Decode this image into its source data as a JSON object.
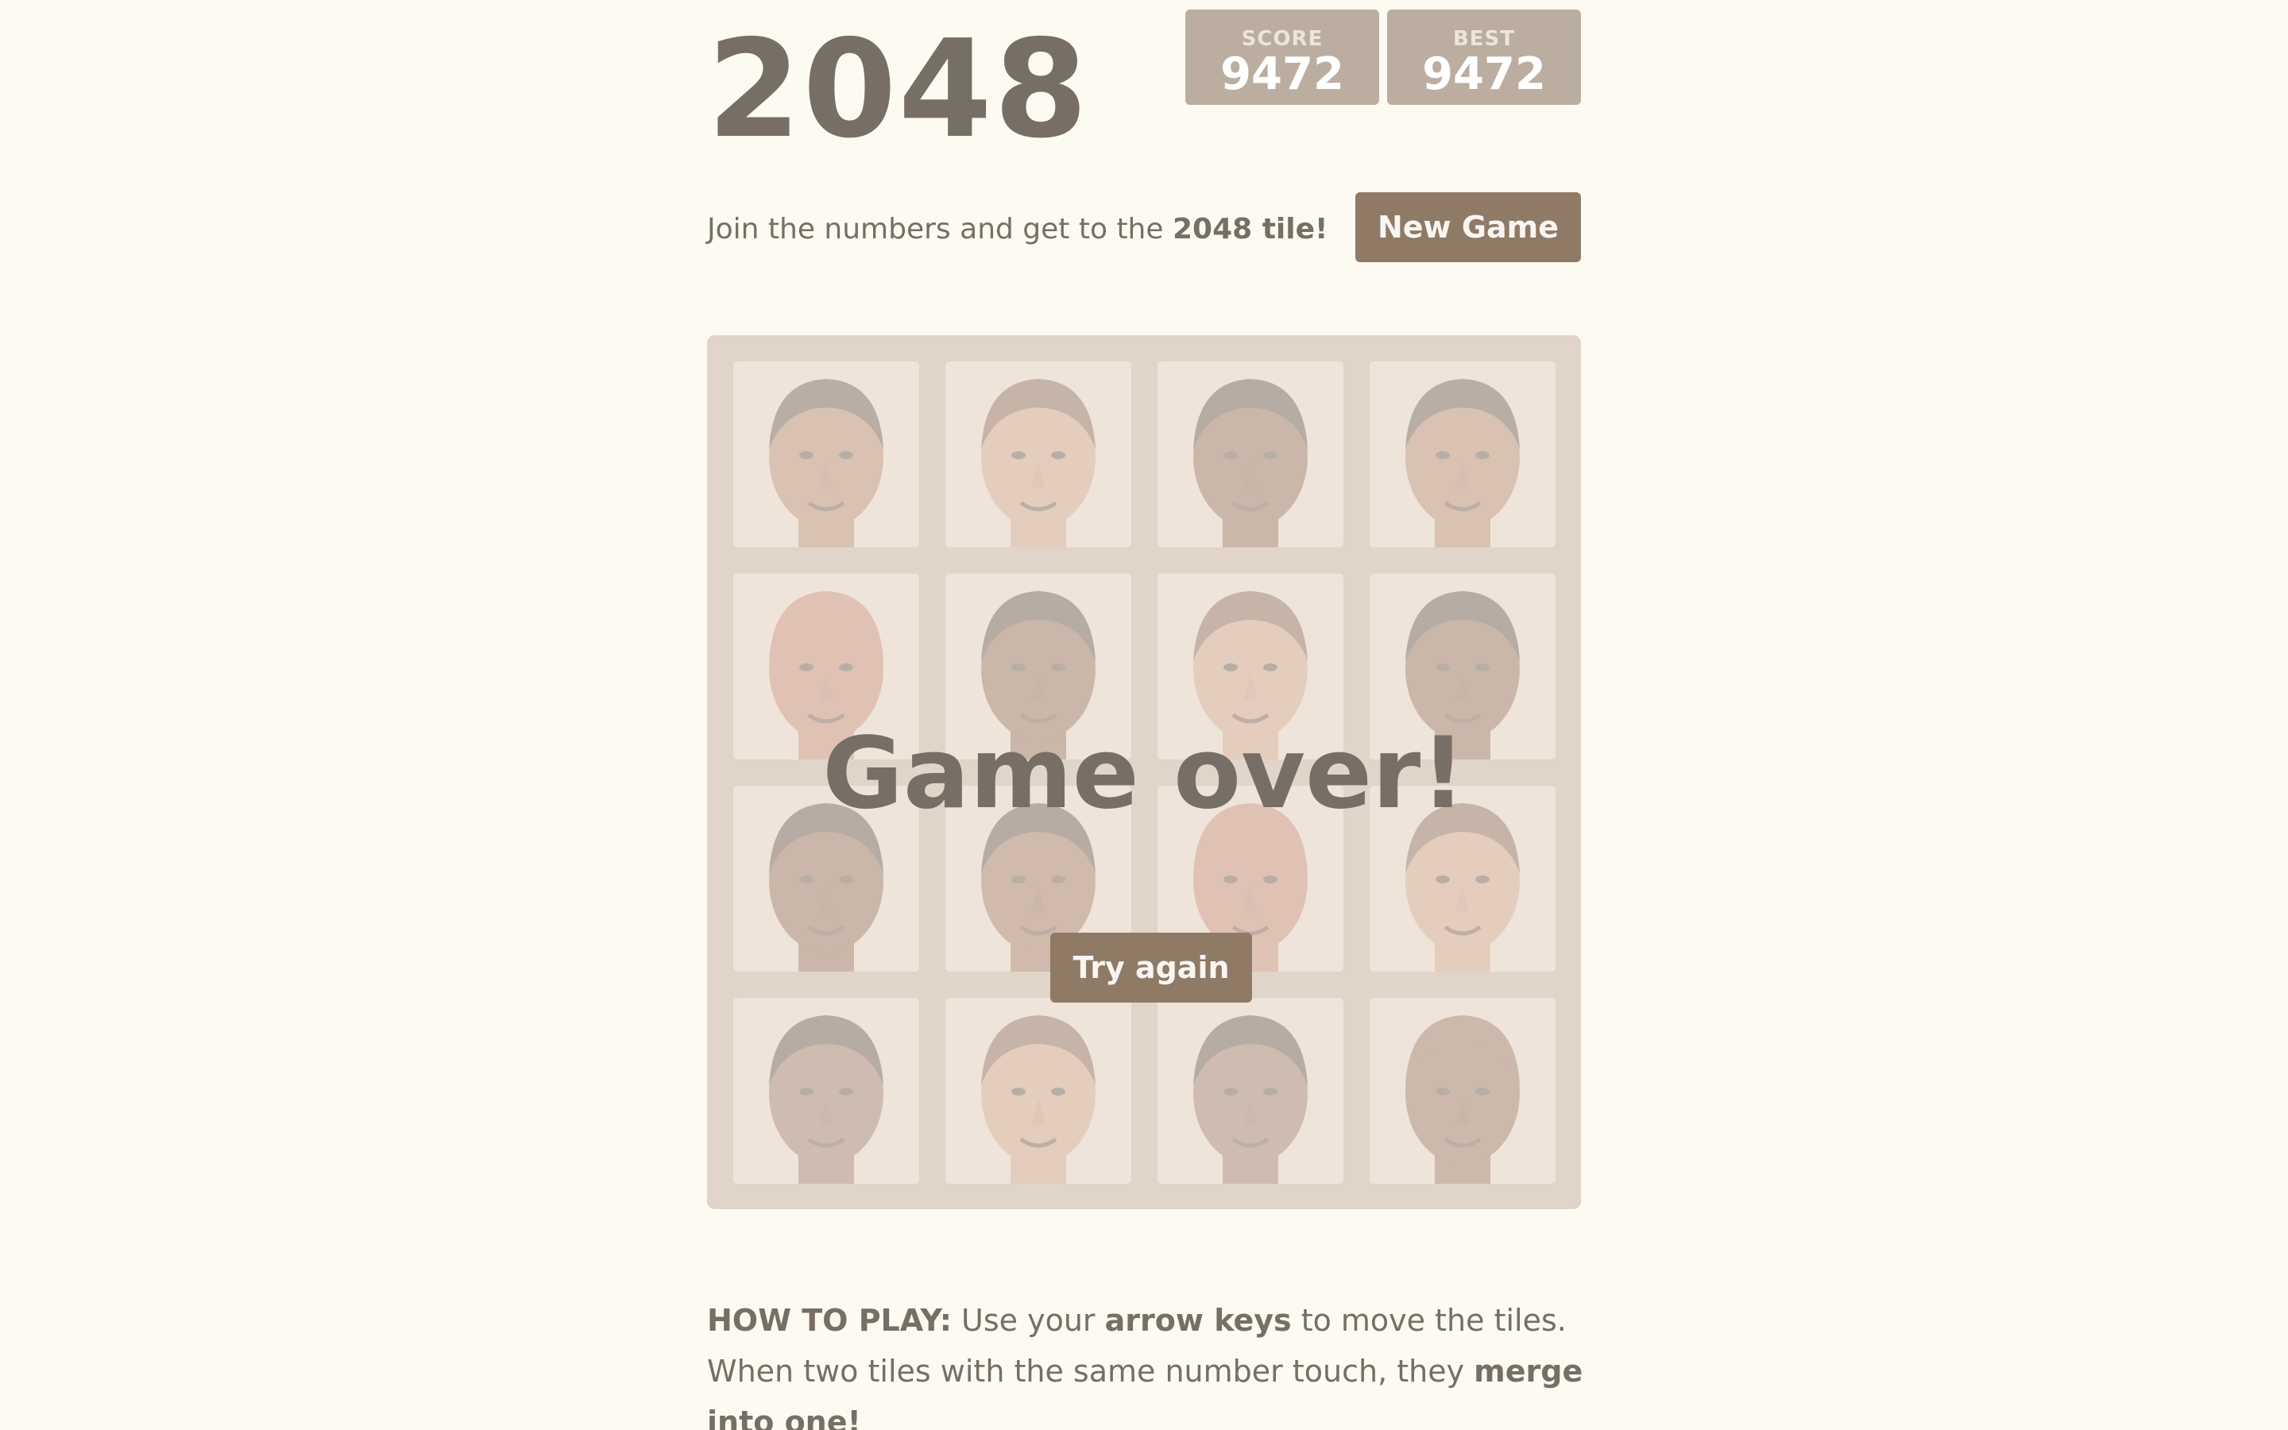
{
  "header": {
    "title": "2048",
    "score_label": "SCORE",
    "score_value": "9472",
    "best_label": "BEST",
    "best_value": "9472"
  },
  "intro": {
    "prefix": "Join the numbers and get to the ",
    "emphasis": "2048 tile!"
  },
  "buttons": {
    "new_game": "New Game",
    "try_again": "Try again"
  },
  "game_over": {
    "message": "Game over!"
  },
  "board": {
    "rows": [
      [
        {
          "face": "player-face-a",
          "skin": "#a06a48",
          "hair": "#2a1e18"
        },
        {
          "face": "player-face-b",
          "skin": "#c98f6f",
          "hair": "#5a3424"
        },
        {
          "face": "player-face-c",
          "skin": "#6b4129",
          "hair": "#1e1612"
        },
        {
          "face": "player-face-a",
          "skin": "#a06a48",
          "hair": "#2a1e18"
        }
      ],
      [
        {
          "face": "player-face-d",
          "skin": "#b96a52",
          "hair": "#b96a52"
        },
        {
          "face": "player-face-e",
          "skin": "#6a3f28",
          "hair": "#1e1612"
        },
        {
          "face": "player-face-b",
          "skin": "#c98f6f",
          "hair": "#5a3424"
        },
        {
          "face": "player-face-c",
          "skin": "#6b4129",
          "hair": "#1e1612"
        }
      ],
      [
        {
          "face": "player-face-e",
          "skin": "#6a3f28",
          "hair": "#1e1612"
        },
        {
          "face": "player-face-f",
          "skin": "#7a4a30",
          "hair": "#1e1612"
        },
        {
          "face": "player-face-d",
          "skin": "#b96a52",
          "hair": "#b96a52"
        },
        {
          "face": "player-face-b",
          "skin": "#c98f6f",
          "hair": "#5a3424"
        }
      ],
      [
        {
          "face": "player-face-g",
          "skin": "#7a5240",
          "hair": "#1e1612"
        },
        {
          "face": "player-face-b",
          "skin": "#c98f6f",
          "hair": "#5a3424"
        },
        {
          "face": "player-face-g",
          "skin": "#7a5240",
          "hair": "#1e1612"
        },
        {
          "face": "player-face-h",
          "skin": "#6e4630",
          "hair": "#6e4630"
        }
      ]
    ]
  },
  "how_to": {
    "label": "HOW TO PLAY:",
    "text1": " Use your ",
    "keys": "arrow keys",
    "text2": " to move the tiles. When two tiles with the same number touch, they ",
    "merge": "merge into one!"
  }
}
